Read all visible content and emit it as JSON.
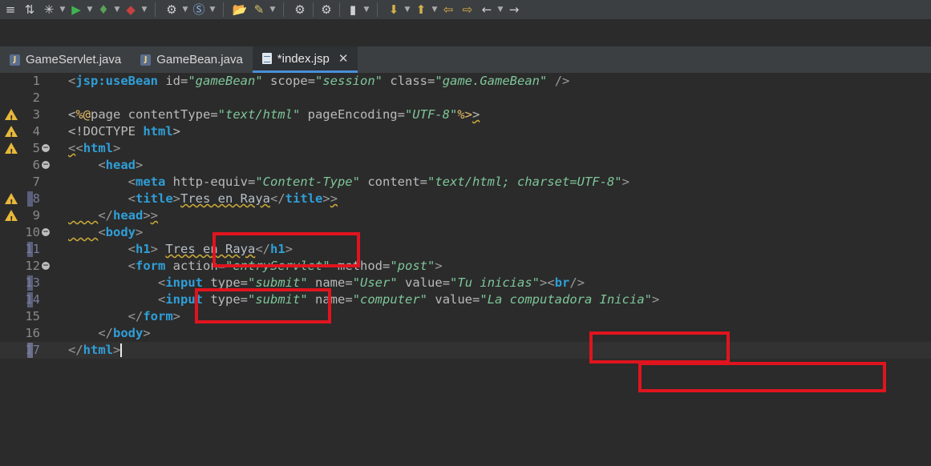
{
  "toolbar": {
    "icons": [
      "≡",
      "⇅",
      "✳",
      "▶",
      "♦",
      "◆",
      "⚙",
      "Ⓢ",
      "📂",
      "✎",
      "⚙",
      "⚙",
      "▮",
      "⬇",
      "⬆",
      "⇦",
      "⇨",
      "←",
      "→"
    ]
  },
  "tabs": [
    {
      "label": "GameServlet.java",
      "icon": "J"
    },
    {
      "label": "GameBean.java",
      "icon": "J"
    },
    {
      "label": "*index.jsp",
      "close": "✕"
    }
  ],
  "lines": [
    {
      "n": "1",
      "t": "<jsp:useBean id=\"gameBean\" scope=\"session\" class=\"game.GameBean\" />"
    },
    {
      "n": "2",
      "t": ""
    },
    {
      "n": "3",
      "t": "<%@page contentType=\"text/html\" pageEncoding=\"UTF-8\"%>"
    },
    {
      "n": "4",
      "t": "<!DOCTYPE html>"
    },
    {
      "n": "5",
      "t": "<html>"
    },
    {
      "n": "6",
      "t": "    <head>"
    },
    {
      "n": "7",
      "t": "        <meta http-equiv=\"Content-Type\" content=\"text/html; charset=UTF-8\">"
    },
    {
      "n": "8",
      "t": "        <title>Tres en Raya</title>"
    },
    {
      "n": "9",
      "t": "    </head>"
    },
    {
      "n": "10",
      "t": "    <body>"
    },
    {
      "n": "11",
      "t": "        <h1> Tres en Raya</h1>"
    },
    {
      "n": "12",
      "t": "        <form action=\"entryServlet\" method=\"post\">"
    },
    {
      "n": "13",
      "t": "            <input type=\"submit\" name=\"User\" value=\"Tu inicias\"><br/>"
    },
    {
      "n": "14",
      "t": "            <input type=\"submit\" name=\"computer\" value=\"La computadora Inicia\">"
    },
    {
      "n": "15",
      "t": "        </form>"
    },
    {
      "n": "16",
      "t": "    </body>"
    },
    {
      "n": "17",
      "t": "</html>"
    }
  ],
  "colors": {
    "highlight_box": "#e0141e",
    "warning": "#e8b83a",
    "tab_underline": "#4a90d9"
  }
}
